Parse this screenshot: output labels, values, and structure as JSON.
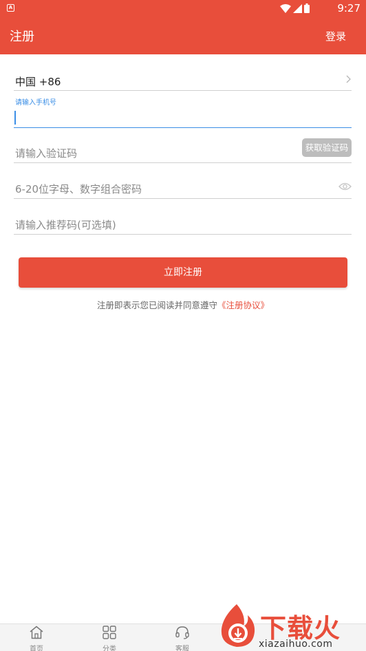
{
  "status_bar": {
    "time": "9:27",
    "notification_icon": "a-box-icon"
  },
  "app_bar": {
    "title": "注册",
    "login_label": "登录"
  },
  "form": {
    "country_code": "中国 +86",
    "phone_label": "请输入手机号",
    "phone_value": "",
    "code_placeholder": "请输入验证码",
    "get_code_label": "获取验证码",
    "password_placeholder": "6-20位字母、数字组合密码",
    "referral_placeholder": "请输入推荐码(可选填)"
  },
  "submit_label": "立即注册",
  "agreement": {
    "text": "注册即表示您已阅读并同意遵守",
    "link": "《注册协议》"
  },
  "tab_bar": {
    "items": [
      {
        "label": "首页",
        "icon": "home-icon"
      },
      {
        "label": "分类",
        "icon": "grid-icon"
      },
      {
        "label": "客服",
        "icon": "headset-icon"
      }
    ]
  },
  "watermark": {
    "brand": "下载火",
    "url": "xiazaihuo.com"
  },
  "colors": {
    "accent": "#e84e3b",
    "focus": "#3a8ee6",
    "disabled": "#bdbdbd"
  }
}
